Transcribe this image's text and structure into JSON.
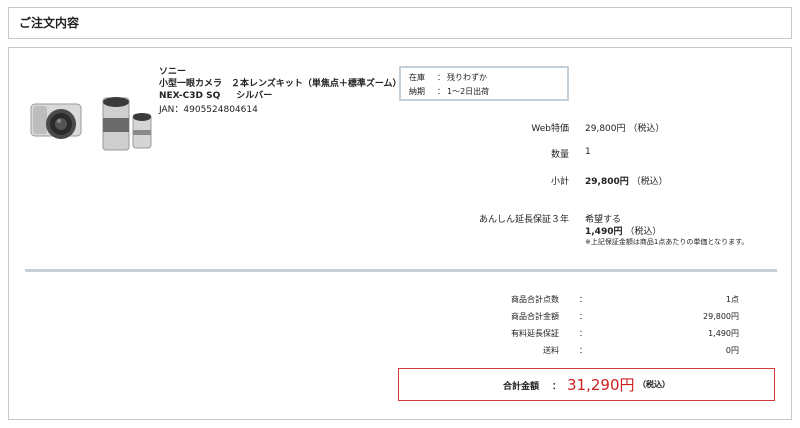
{
  "header": {
    "title": "ご注文内容"
  },
  "product": {
    "brand": "ソニー",
    "name": "小型一眼カメラ　２本レンズキット（単焦点＋標準ズーム）",
    "model": "NEX-C3D SQ",
    "color": "シルバー",
    "jan_label": "JAN：",
    "jan": "4905524804614",
    "image_alt": "camera-with-two-lenses"
  },
  "stock": {
    "stock_label": "在庫",
    "stock_value": "残りわずか",
    "delivery_label": "納期",
    "delivery_value": "1～2日出荷",
    "separator": "："
  },
  "details": {
    "web_price_label": "Web特価",
    "web_price_value": "29,800円",
    "web_price_tax": "（税込）",
    "quantity_label": "数量",
    "quantity_value": "1",
    "subtotal_label": "小計",
    "subtotal_value": "29,800円",
    "subtotal_tax": "（税込）",
    "warranty_label": "あんしん延長保証３年",
    "warranty_choice": "希望する",
    "warranty_price": "1,490円",
    "warranty_tax": "（税込）",
    "warranty_note": "※上記保証金額は商品1点あたりの単価となります。"
  },
  "summary": {
    "colon": "：",
    "rows": [
      {
        "label": "商品合計点数",
        "value": "1点"
      },
      {
        "label": "商品合計金額",
        "value": "29,800円"
      },
      {
        "label": "有料延長保証",
        "value": "1,490円"
      },
      {
        "label": "送料",
        "value": "0円"
      }
    ]
  },
  "total": {
    "label": "合計金額",
    "colon": "：",
    "amount": "31,290円",
    "tax": "（税込）"
  },
  "colors": {
    "border": "#c8c8c8",
    "divider": "#c3cfd9",
    "total_border": "#d23b3b",
    "total_amount": "#cc1f1f"
  }
}
